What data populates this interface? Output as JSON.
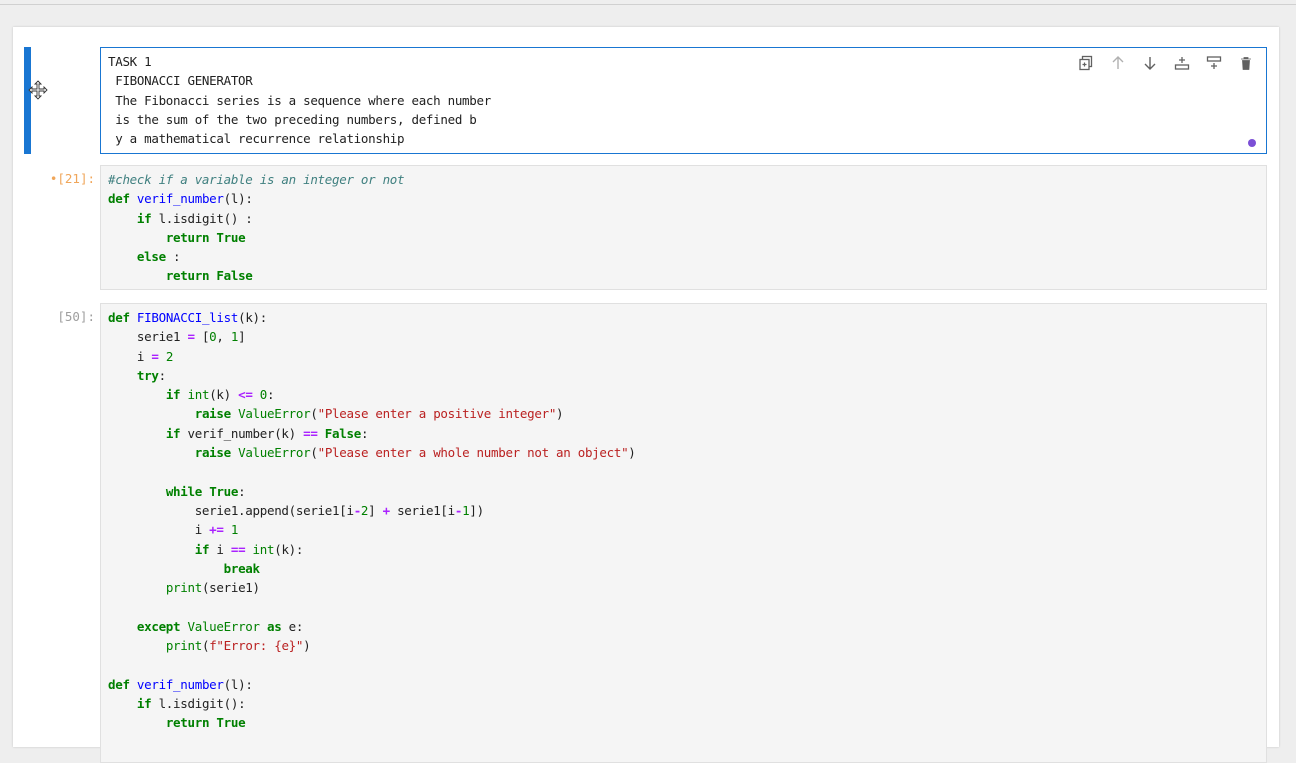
{
  "cells": [
    {
      "type": "markdown",
      "prompt": "",
      "lines": [
        "TASK 1",
        " FIBONACCI GENERATOR",
        " The Fibonacci series is a sequence where each number",
        " is the sum of the two preceding numbers, defined b",
        " y a mathematical recurrence relationship"
      ]
    },
    {
      "type": "code",
      "prompt": "•[21]:",
      "lines": [
        "#check if a variable is an integer or not",
        "def verif_number(l):",
        "    if l.isdigit() :",
        "        return True",
        "    else :",
        "        return False"
      ]
    },
    {
      "type": "code",
      "prompt": "[50]:",
      "lines": [
        "def FIBONACCI_list(k):",
        "    serie1 = [0, 1]",
        "    i = 2",
        "    try:",
        "        if int(k) <= 0:",
        "            raise ValueError(\"Please enter a positive integer\")",
        "        if verif_number(k) == False:",
        "            raise ValueError(\"Please enter a whole number not an object\")",
        "",
        "        while True:",
        "            serie1.append(serie1[i-2] + serie1[i-1])",
        "            i += 1",
        "            if i == int(k):",
        "                break",
        "        print(serie1)",
        "",
        "    except ValueError as e:",
        "        print(f\"Error: {e}\")",
        "",
        "def verif_number(l):",
        "    if l.isdigit():",
        "        return True"
      ]
    }
  ],
  "cell_toolbar": {
    "icons": [
      "duplicate-icon",
      "move-up-icon",
      "move-down-icon",
      "insert-above-icon",
      "insert-below-icon",
      "delete-icon"
    ]
  },
  "colors": {
    "active_cell": "#1976d2",
    "dirty_prompt": "#f0a65a",
    "unsaved_dot": "#7b4fd6"
  }
}
